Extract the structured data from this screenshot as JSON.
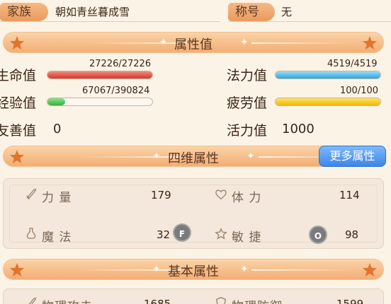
{
  "top": {
    "family_label": "家族",
    "family_value": "朝如青丝暮成雪",
    "title_label": "称号",
    "title_value": "无"
  },
  "sections": {
    "attributes": "属性值",
    "four_dim": "四维属性",
    "basic": "基本属性"
  },
  "stats": {
    "hp_label": "生命值",
    "hp_value": "27226/27226",
    "hp_fraction": 1.0,
    "mp_label": "法力值",
    "mp_value": "4519/4519",
    "mp_fraction": 1.0,
    "exp_label": "经验值",
    "exp_value": "67067/390824",
    "exp_fraction": 0.17,
    "fatigue_label": "疲劳值",
    "fatigue_value": "100/100",
    "fatigue_fraction": 1.0,
    "friendly_label": "友善值",
    "friendly_value": "0",
    "vitality_label": "活力值",
    "vitality_value": "1000"
  },
  "more_button": "更多属性",
  "four_dim": {
    "strength_label": "力 量",
    "strength_value": "179",
    "stamina_label": "体 力",
    "stamina_value": "114",
    "magic_label": "魔 法",
    "magic_value": "32",
    "agility_label": "敏 捷",
    "agility_value": "98"
  },
  "overlay": {
    "f_key": "F",
    "o_key": "O"
  },
  "basic": {
    "phys_atk_label": "物理攻击",
    "phys_atk_value": "1685",
    "phys_def_label": "物理防御",
    "phys_def_value": "1599"
  },
  "colors": {
    "hp": "#e24a3e",
    "mp": "#3bb3ea",
    "exp": "#45c04a",
    "fatigue": "#f5c316",
    "banner": "#f2ae74",
    "button": "#3d86e6"
  },
  "icons": {
    "strength": "sword-icon",
    "stamina": "heart-icon",
    "magic": "potion-icon",
    "agility": "flower-icon",
    "banner_star": "star-icon",
    "banner_diamond": "diamond-icon"
  }
}
